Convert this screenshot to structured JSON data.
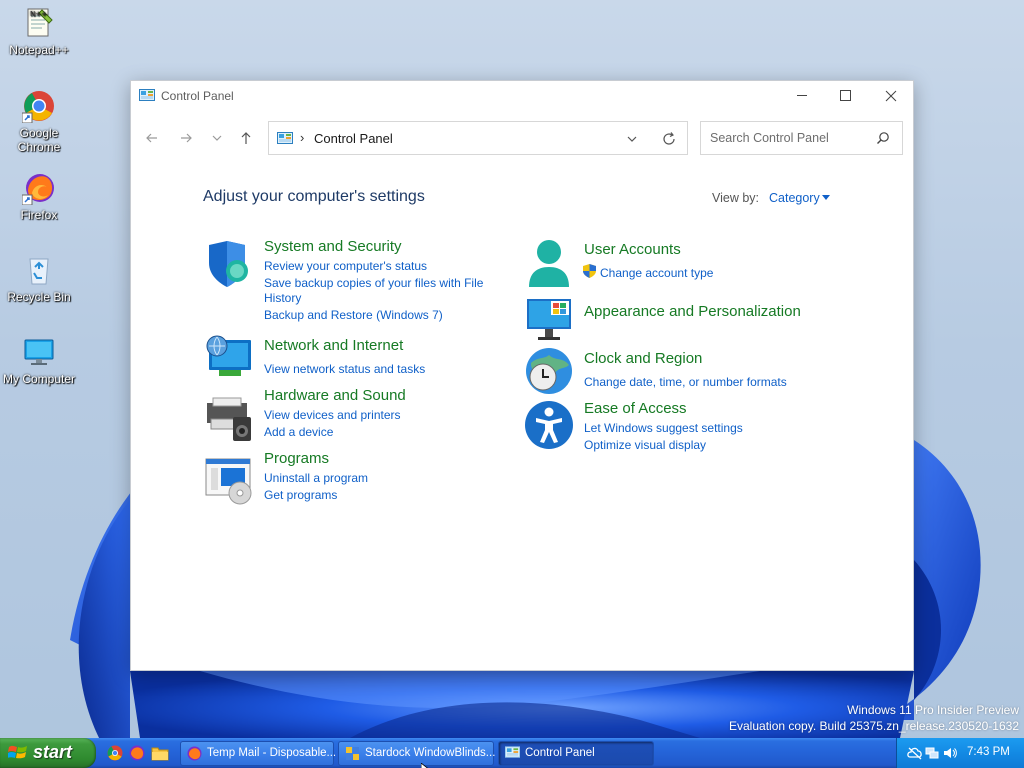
{
  "desktop": {
    "icons": [
      {
        "label": "Notepad++",
        "icon": "notepadpp-icon"
      },
      {
        "label": "Google Chrome",
        "icon": "chrome-icon"
      },
      {
        "label": "Firefox",
        "icon": "firefox-icon"
      },
      {
        "label": "Recycle Bin",
        "icon": "recycle-bin-icon"
      },
      {
        "label": "My Computer",
        "icon": "my-computer-icon"
      }
    ],
    "watermark": {
      "line1": "Windows 11 Pro Insider Preview",
      "line2": "Evaluation copy. Build 25375.zn_release.230520-1632"
    }
  },
  "window": {
    "title": "Control Panel",
    "address": {
      "separator": "›",
      "crumb": "Control Panel"
    },
    "search": {
      "placeholder": "Search Control Panel"
    },
    "heading": "Adjust your computer's settings",
    "view_by": {
      "label": "View by:",
      "value": "Category"
    },
    "categories": {
      "system_security": {
        "title": "System and Security",
        "links": [
          "Review your computer's status",
          "Save backup copies of your files with File",
          "History",
          "Backup and Restore (Windows 7)"
        ]
      },
      "network": {
        "title": "Network and Internet",
        "links": [
          "View network status and tasks"
        ]
      },
      "hardware": {
        "title": "Hardware and Sound",
        "links": [
          "View devices and printers",
          "Add a device"
        ]
      },
      "programs": {
        "title": "Programs",
        "links": [
          "Uninstall a program",
          "Get programs"
        ]
      },
      "user_accounts": {
        "title": "User Accounts",
        "links": [
          "Change account type"
        ]
      },
      "appearance": {
        "title": "Appearance and Personalization",
        "links": []
      },
      "clock": {
        "title": "Clock and Region",
        "links": [
          "Change date, time, or number formats"
        ]
      },
      "ease": {
        "title": "Ease of Access",
        "links": [
          "Let Windows suggest settings",
          "Optimize visual display"
        ]
      }
    }
  },
  "taskbar": {
    "start_label": "start",
    "buttons": [
      {
        "label": "Temp Mail - Disposable...",
        "icon": "firefox-icon"
      },
      {
        "label": "Stardock WindowBlinds...",
        "icon": "windowblinds-icon"
      },
      {
        "label": "Control Panel",
        "icon": "control-panel-icon",
        "active": true
      }
    ],
    "clock": "7:43 PM"
  },
  "colors": {
    "link": "#1060c8",
    "category_title": "#167a24",
    "heading": "#1e3a66",
    "taskbar": "#2463d8",
    "start_button": "#3d9a3d"
  }
}
